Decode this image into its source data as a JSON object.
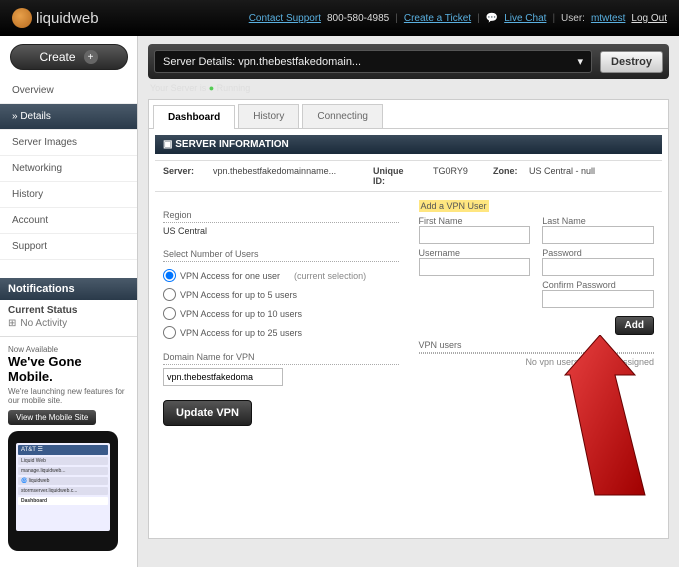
{
  "topbar": {
    "brand": "liquidweb",
    "contact": "Contact Support",
    "phone": "800-580-4985",
    "ticket": "Create a Ticket",
    "chat": "Live Chat",
    "user_label": "User:",
    "user": "mtwtest",
    "logout": "Log Out"
  },
  "sidebar": {
    "create": "Create",
    "items": [
      "Overview",
      "» Details",
      "Server Images",
      "Networking",
      "History",
      "Account",
      "Support"
    ],
    "active_index": 1,
    "notifications": {
      "title": "Notifications",
      "status_label": "Current Status",
      "status_value": "No Activity"
    },
    "promo": {
      "now": "Now Available",
      "headline": "We've Gone Mobile.",
      "sub": "We're launching new features for our mobile site.",
      "btn": "View the Mobile Site",
      "phone_label": "Dashboard"
    }
  },
  "main": {
    "server_select": "Server Details: vpn.thebestfakedomain...",
    "destroy": "Destroy",
    "status_prefix": "Your Server is",
    "status_value": "Running",
    "tabs": [
      "Dashboard",
      "History",
      "Connecting"
    ],
    "active_tab": 0,
    "section_title": "SERVER INFORMATION",
    "info": {
      "server_label": "Server:",
      "server_value": "vpn.thebestfakedomainname...",
      "uid_label": "Unique ID:",
      "uid_value": "TG0RY9",
      "zone_label": "Zone:",
      "zone_value": "US Central - null"
    },
    "left": {
      "region_label": "Region",
      "region_value": "US Central",
      "users_label": "Select Number of Users",
      "options": [
        "VPN Access for one user",
        "VPN Access for up to 5 users",
        "VPN Access for up to 10 users",
        "VPN Access for up to 25 users"
      ],
      "current": "(current selection)",
      "domain_label": "Domain Name for VPN",
      "domain_value": "vpn.thebestfakedoma",
      "update": "Update VPN"
    },
    "right": {
      "add_title": "Add a VPN User",
      "first": "First Name",
      "last": "Last Name",
      "username": "Username",
      "password": "Password",
      "confirm": "Confirm Password",
      "add": "Add",
      "vpn_users_label": "VPN users",
      "no_users": "No vpn users currently assigned"
    }
  }
}
